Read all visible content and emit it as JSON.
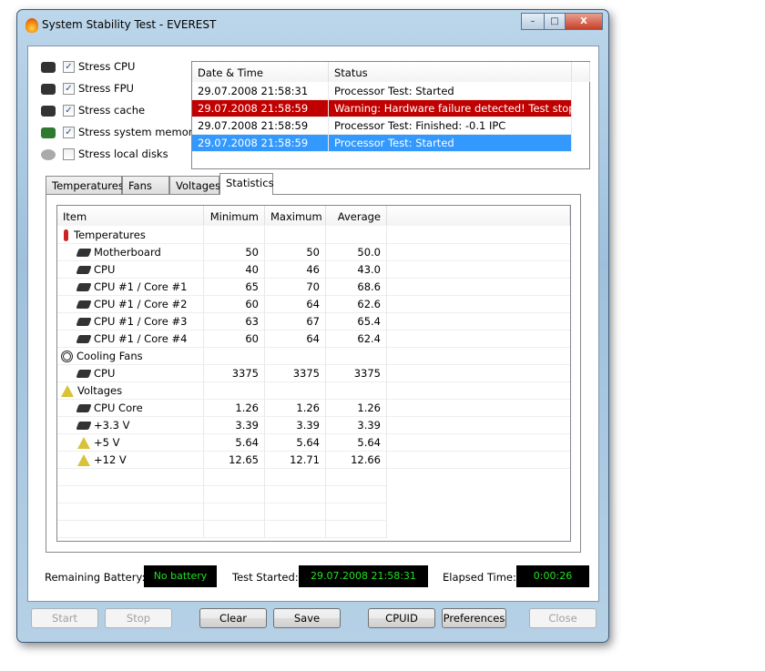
{
  "window": {
    "title": "System Stability Test - EVEREST",
    "minimize": "–",
    "maximize": "□",
    "close": "X"
  },
  "stress": [
    {
      "label": "Stress CPU",
      "checked": true,
      "icon": "cpu-icon"
    },
    {
      "label": "Stress FPU",
      "checked": true,
      "icon": "fpu-icon"
    },
    {
      "label": "Stress cache",
      "checked": true,
      "icon": "cache-icon"
    },
    {
      "label": "Stress system memory",
      "checked": true,
      "icon": "memory-icon"
    },
    {
      "label": "Stress local disks",
      "checked": false,
      "icon": "disk-icon"
    }
  ],
  "log": {
    "headers": [
      "Date & Time",
      "Status"
    ],
    "rows": [
      {
        "time": "29.07.2008 21:58:31",
        "status": "Processor Test: Started",
        "state": "normal"
      },
      {
        "time": "29.07.2008 21:58:59",
        "status": "Warning: Hardware failure detected! Test stop...",
        "state": "error"
      },
      {
        "time": "29.07.2008 21:58:59",
        "status": "Processor Test: Finished: -0.1 IPC",
        "state": "normal"
      },
      {
        "time": "29.07.2008 21:58:59",
        "status": "Processor Test: Started",
        "state": "selected"
      }
    ]
  },
  "tabs": [
    "Temperatures",
    "Fans",
    "Voltages",
    "Statistics"
  ],
  "active_tab": "Statistics",
  "stats": {
    "headers": [
      "Item",
      "Minimum",
      "Maximum",
      "Average"
    ],
    "rows": [
      {
        "item": "Temperatures",
        "group": true,
        "icon": "thermometer"
      },
      {
        "item": "Motherboard",
        "min": "50",
        "max": "50",
        "avg": "50.0",
        "icon": "chip"
      },
      {
        "item": "CPU",
        "min": "40",
        "max": "46",
        "avg": "43.0",
        "icon": "chip"
      },
      {
        "item": "CPU #1 / Core #1",
        "min": "65",
        "max": "70",
        "avg": "68.6",
        "icon": "chip"
      },
      {
        "item": "CPU #1 / Core #2",
        "min": "60",
        "max": "64",
        "avg": "62.6",
        "icon": "chip"
      },
      {
        "item": "CPU #1 / Core #3",
        "min": "63",
        "max": "67",
        "avg": "65.4",
        "icon": "chip"
      },
      {
        "item": "CPU #1 / Core #4",
        "min": "60",
        "max": "64",
        "avg": "62.4",
        "icon": "chip"
      },
      {
        "item": "Cooling Fans",
        "group": true,
        "icon": "fan"
      },
      {
        "item": "CPU",
        "min": "3375",
        "max": "3375",
        "avg": "3375",
        "icon": "chip"
      },
      {
        "item": "Voltages",
        "group": true,
        "icon": "voltage"
      },
      {
        "item": "CPU Core",
        "min": "1.26",
        "max": "1.26",
        "avg": "1.26",
        "icon": "chip"
      },
      {
        "item": "+3.3 V",
        "min": "3.39",
        "max": "3.39",
        "avg": "3.39",
        "icon": "chip"
      },
      {
        "item": "+5 V",
        "min": "5.64",
        "max": "5.64",
        "avg": "5.64",
        "icon": "voltage"
      },
      {
        "item": "+12 V",
        "min": "12.65",
        "max": "12.71",
        "avg": "12.66",
        "icon": "voltage"
      }
    ]
  },
  "status": {
    "battery_label": "Remaining Battery:",
    "battery_value": "No battery",
    "started_label": "Test Started:",
    "started_value": "29.07.2008 21:58:31",
    "elapsed_label": "Elapsed Time:",
    "elapsed_value": "0:00:26"
  },
  "buttons": [
    {
      "label": "Start",
      "enabled": false
    },
    {
      "label": "Stop",
      "enabled": false
    },
    {
      "label": "Clear",
      "enabled": true
    },
    {
      "label": "Save",
      "enabled": true
    },
    {
      "label": "CPUID",
      "enabled": true
    },
    {
      "label": "Preferences",
      "enabled": true
    },
    {
      "label": "Close",
      "enabled": false
    }
  ],
  "colors": {
    "error": "#c00000",
    "selected": "#3399ff",
    "lcd_text": "#22e022"
  }
}
